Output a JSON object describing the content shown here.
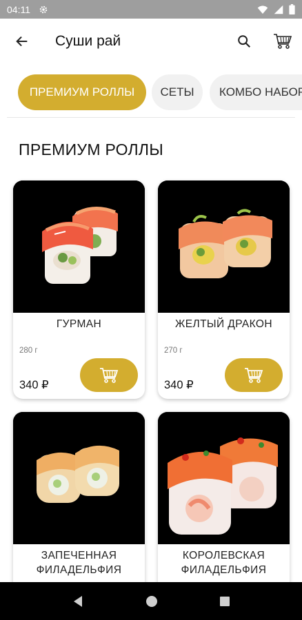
{
  "status": {
    "time": "04:11"
  },
  "header": {
    "title": "Суши рай"
  },
  "categories": [
    {
      "label": "ПРЕМИУМ РОЛЛЫ",
      "active": true
    },
    {
      "label": "СЕТЫ",
      "active": false
    },
    {
      "label": "КОМБО НАБОРЫ",
      "active": false
    }
  ],
  "section": {
    "title": "ПРЕМИУМ РОЛЛЫ"
  },
  "products": [
    {
      "name": "ГУРМАН",
      "weight": "280 г",
      "price": "340 ₽"
    },
    {
      "name": "ЖЕЛТЫЙ ДРАКОН",
      "weight": "270 г",
      "price": "340 ₽"
    },
    {
      "name": "ЗАПЕЧЕННАЯ ФИЛАДЕЛЬФИЯ",
      "weight": "",
      "price": ""
    },
    {
      "name": "КОРОЛЕВСКАЯ ФИЛАДЕЛЬФИЯ",
      "weight": "",
      "price": ""
    }
  ],
  "colors": {
    "accent": "#d3ad2f",
    "statusbar": "#9e9e9e"
  },
  "icons": [
    "back-arrow-icon",
    "search-icon",
    "cart-icon",
    "nav-back-icon",
    "nav-home-icon",
    "nav-recents-icon"
  ]
}
